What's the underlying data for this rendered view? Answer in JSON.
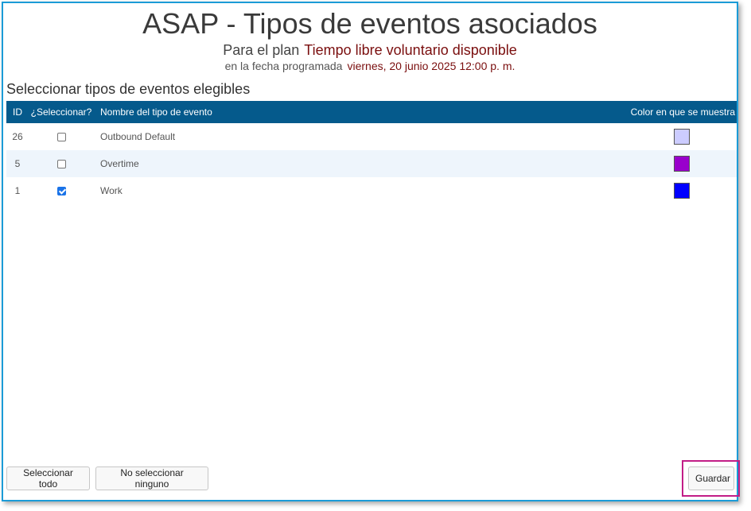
{
  "header": {
    "title": "ASAP - Tipos de eventos asociados",
    "plan_label": "Para el plan",
    "plan_value": "Tiempo libre voluntario disponible",
    "date_label": "en la fecha programada",
    "date_value": "viernes, 20 junio 2025 12:00 p. m."
  },
  "section": {
    "title": "Seleccionar tipos de eventos elegibles"
  },
  "table": {
    "headers": {
      "id": "ID",
      "select": "¿Seleccionar?",
      "name": "Nombre del tipo de evento",
      "color": "Color en que se muestra"
    },
    "rows": [
      {
        "id": "26",
        "checked": false,
        "name": "Outbound Default",
        "color": "#ccccff"
      },
      {
        "id": "5",
        "checked": false,
        "name": "Overtime",
        "color": "#9900cc"
      },
      {
        "id": "1",
        "checked": true,
        "name": "Work",
        "color": "#0000ff"
      }
    ]
  },
  "buttons": {
    "select_all": "Seleccionar todo",
    "select_none": "No seleccionar ninguno",
    "save": "Guardar"
  },
  "colors": {
    "header_bg": "#055a8c",
    "accent_text": "#7a0e0e",
    "highlight": "#c21d87",
    "window_border": "#1b9bd7"
  }
}
